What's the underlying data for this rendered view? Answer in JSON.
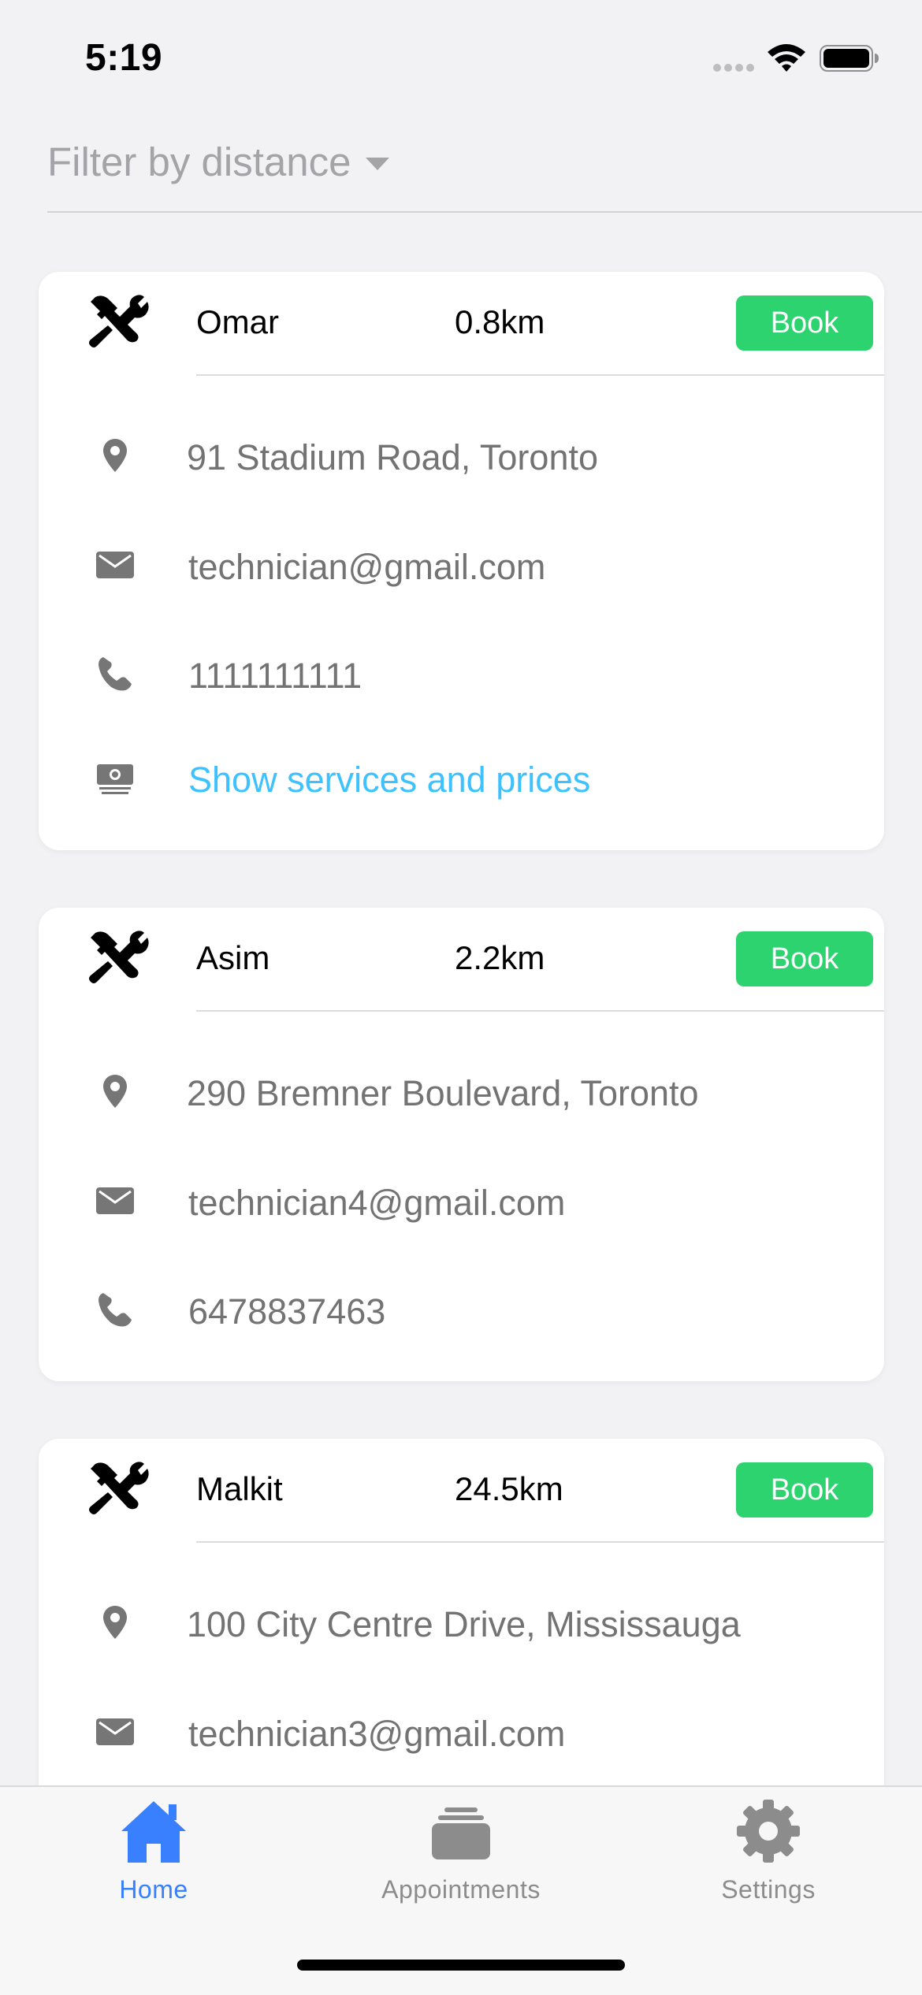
{
  "status_bar": {
    "time": "5:19"
  },
  "filter": {
    "label": "Filter by distance"
  },
  "technicians": [
    {
      "name": "Omar",
      "distance": "0.8km",
      "book_label": "Book",
      "address": "91 Stadium Road, Toronto",
      "email": "technician@gmail.com",
      "phone": "1111111111",
      "services_link": "Show services and prices"
    },
    {
      "name": "Asim",
      "distance": "2.2km",
      "book_label": "Book",
      "address": "290 Bremner Boulevard, Toronto",
      "email": "technician4@gmail.com",
      "phone": "6478837463"
    },
    {
      "name": "Malkit",
      "distance": "24.5km",
      "book_label": "Book",
      "address": "100 City Centre Drive, Mississauga",
      "email": "technician3@gmail.com"
    }
  ],
  "tab_bar": {
    "tabs": [
      {
        "label": "Home",
        "icon": "home-icon",
        "active": true
      },
      {
        "label": "Appointments",
        "icon": "appointments-icon",
        "active": false
      },
      {
        "label": "Settings",
        "icon": "gear-icon",
        "active": false
      }
    ]
  },
  "colors": {
    "book_button": "#2dd36f",
    "link": "#3dc2ff",
    "active_tab": "#3880ff",
    "inactive_tab": "#8c8c8c",
    "secondary_text": "#737373"
  }
}
